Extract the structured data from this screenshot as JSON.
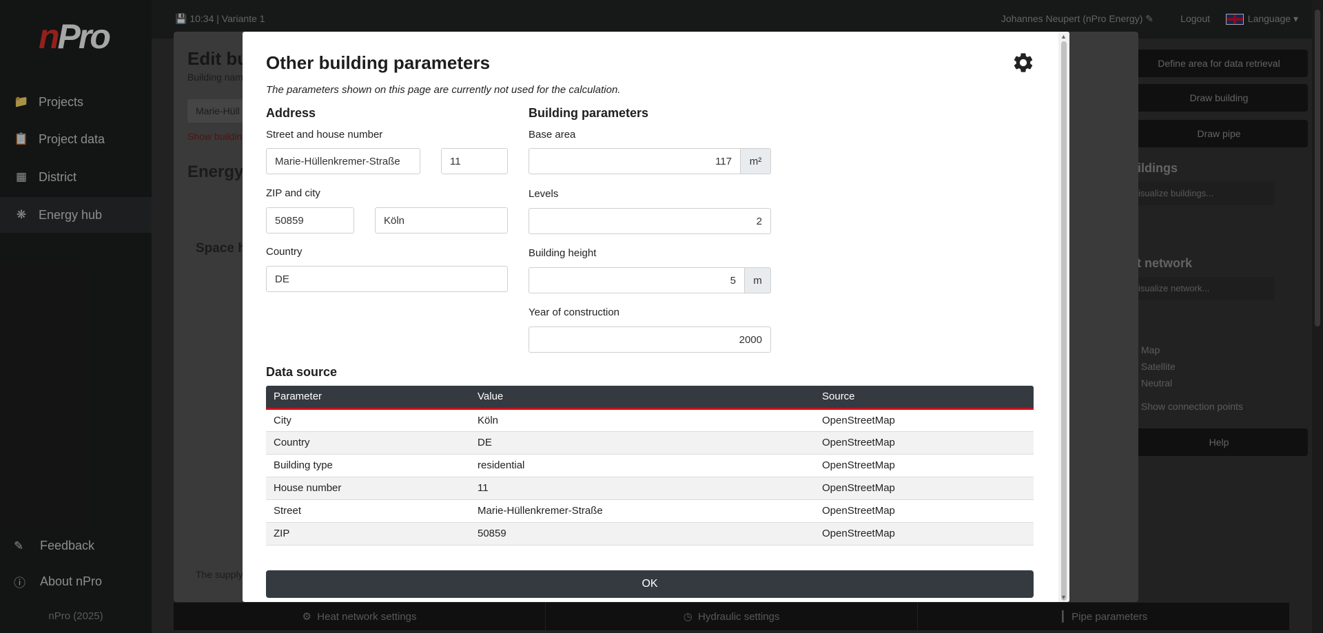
{
  "app": {
    "logo_n": "n",
    "logo_rest": "Pro",
    "copyright": "nPro (2025)"
  },
  "sidebar": {
    "items": [
      {
        "label": "Projects",
        "icon": "folder-icon"
      },
      {
        "label": "Project data",
        "icon": "clipboard-icon"
      },
      {
        "label": "District",
        "icon": "map-icon"
      },
      {
        "label": "Energy hub",
        "icon": "network-icon"
      }
    ],
    "feedback": "Feedback",
    "about": "About nPro"
  },
  "topbar": {
    "status": "10:34  |  Variante 1",
    "user": "Johannes Neupert (nPro Energy)",
    "logout": "Logout",
    "language": "Language"
  },
  "right_panel": {
    "define_area": "Define area for data retrieval",
    "draw_building": "Draw building",
    "draw_pipe": "Draw pipe",
    "buildings_heading": "uildings",
    "visualize_buildings": "isualize buildings...",
    "heat_network_heading": "at network",
    "visualize_network": "isualize network...",
    "map_options": [
      "Map",
      "Satellite",
      "Neutral"
    ],
    "show_connection_points": "Show connection points",
    "help": "Help"
  },
  "edit_dialog": {
    "title": "Edit bu",
    "building_name_label": "Building nam",
    "building_name_value": "Marie-Hüll",
    "show_building": "Show buildin",
    "energy_heading": "Energy",
    "space_heading": "Space h",
    "supply_text": "The supply"
  },
  "bottombar": {
    "heat_network_settings": "Heat network settings",
    "hydraulic_settings": "Hydraulic settings",
    "pipe_parameters": "Pipe parameters"
  },
  "modal": {
    "title": "Other building parameters",
    "note": "The parameters shown on this page are currently not used for the calculation.",
    "address": {
      "heading": "Address",
      "street_label": "Street and house number",
      "street": "Marie-Hüllenkremer-Straße",
      "house_number": "11",
      "zip_city_label": "ZIP and city",
      "zip": "50859",
      "city": "Köln",
      "country_label": "Country",
      "country": "DE"
    },
    "building": {
      "heading": "Building parameters",
      "base_area_label": "Base area",
      "base_area": "117",
      "base_area_unit": "m²",
      "levels_label": "Levels",
      "levels": "2",
      "height_label": "Building height",
      "height": "5",
      "height_unit": "m",
      "year_label": "Year of construction",
      "year": "2000"
    },
    "data_source": {
      "heading": "Data source",
      "columns": [
        "Parameter",
        "Value",
        "Source"
      ],
      "rows": [
        [
          "City",
          "Köln",
          "OpenStreetMap"
        ],
        [
          "Country",
          "DE",
          "OpenStreetMap"
        ],
        [
          "Building type",
          "residential",
          "OpenStreetMap"
        ],
        [
          "House number",
          "11",
          "OpenStreetMap"
        ],
        [
          "Street",
          "Marie-Hüllenkremer-Straße",
          "OpenStreetMap"
        ],
        [
          "ZIP",
          "50859",
          "OpenStreetMap"
        ]
      ]
    },
    "ok": "OK"
  },
  "colors": {
    "brand_red": "#e4322b",
    "dark": "#343a40",
    "table_accent": "#c8101d"
  }
}
